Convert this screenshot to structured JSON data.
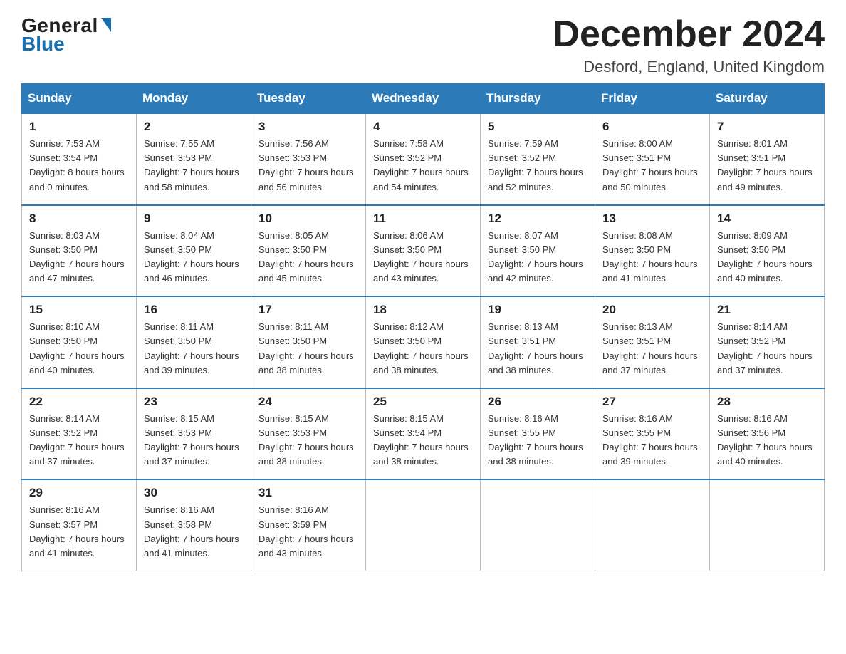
{
  "header": {
    "logo": {
      "general": "General",
      "blue": "Blue",
      "triangle": true
    },
    "month_title": "December 2024",
    "location": "Desford, England, United Kingdom"
  },
  "calendar": {
    "days_of_week": [
      "Sunday",
      "Monday",
      "Tuesday",
      "Wednesday",
      "Thursday",
      "Friday",
      "Saturday"
    ],
    "weeks": [
      [
        {
          "day": "1",
          "sunrise": "7:53 AM",
          "sunset": "3:54 PM",
          "daylight": "8 hours and 0 minutes."
        },
        {
          "day": "2",
          "sunrise": "7:55 AM",
          "sunset": "3:53 PM",
          "daylight": "7 hours and 58 minutes."
        },
        {
          "day": "3",
          "sunrise": "7:56 AM",
          "sunset": "3:53 PM",
          "daylight": "7 hours and 56 minutes."
        },
        {
          "day": "4",
          "sunrise": "7:58 AM",
          "sunset": "3:52 PM",
          "daylight": "7 hours and 54 minutes."
        },
        {
          "day": "5",
          "sunrise": "7:59 AM",
          "sunset": "3:52 PM",
          "daylight": "7 hours and 52 minutes."
        },
        {
          "day": "6",
          "sunrise": "8:00 AM",
          "sunset": "3:51 PM",
          "daylight": "7 hours and 50 minutes."
        },
        {
          "day": "7",
          "sunrise": "8:01 AM",
          "sunset": "3:51 PM",
          "daylight": "7 hours and 49 minutes."
        }
      ],
      [
        {
          "day": "8",
          "sunrise": "8:03 AM",
          "sunset": "3:50 PM",
          "daylight": "7 hours and 47 minutes."
        },
        {
          "day": "9",
          "sunrise": "8:04 AM",
          "sunset": "3:50 PM",
          "daylight": "7 hours and 46 minutes."
        },
        {
          "day": "10",
          "sunrise": "8:05 AM",
          "sunset": "3:50 PM",
          "daylight": "7 hours and 45 minutes."
        },
        {
          "day": "11",
          "sunrise": "8:06 AM",
          "sunset": "3:50 PM",
          "daylight": "7 hours and 43 minutes."
        },
        {
          "day": "12",
          "sunrise": "8:07 AM",
          "sunset": "3:50 PM",
          "daylight": "7 hours and 42 minutes."
        },
        {
          "day": "13",
          "sunrise": "8:08 AM",
          "sunset": "3:50 PM",
          "daylight": "7 hours and 41 minutes."
        },
        {
          "day": "14",
          "sunrise": "8:09 AM",
          "sunset": "3:50 PM",
          "daylight": "7 hours and 40 minutes."
        }
      ],
      [
        {
          "day": "15",
          "sunrise": "8:10 AM",
          "sunset": "3:50 PM",
          "daylight": "7 hours and 40 minutes."
        },
        {
          "day": "16",
          "sunrise": "8:11 AM",
          "sunset": "3:50 PM",
          "daylight": "7 hours and 39 minutes."
        },
        {
          "day": "17",
          "sunrise": "8:11 AM",
          "sunset": "3:50 PM",
          "daylight": "7 hours and 38 minutes."
        },
        {
          "day": "18",
          "sunrise": "8:12 AM",
          "sunset": "3:50 PM",
          "daylight": "7 hours and 38 minutes."
        },
        {
          "day": "19",
          "sunrise": "8:13 AM",
          "sunset": "3:51 PM",
          "daylight": "7 hours and 38 minutes."
        },
        {
          "day": "20",
          "sunrise": "8:13 AM",
          "sunset": "3:51 PM",
          "daylight": "7 hours and 37 minutes."
        },
        {
          "day": "21",
          "sunrise": "8:14 AM",
          "sunset": "3:52 PM",
          "daylight": "7 hours and 37 minutes."
        }
      ],
      [
        {
          "day": "22",
          "sunrise": "8:14 AM",
          "sunset": "3:52 PM",
          "daylight": "7 hours and 37 minutes."
        },
        {
          "day": "23",
          "sunrise": "8:15 AM",
          "sunset": "3:53 PM",
          "daylight": "7 hours and 37 minutes."
        },
        {
          "day": "24",
          "sunrise": "8:15 AM",
          "sunset": "3:53 PM",
          "daylight": "7 hours and 38 minutes."
        },
        {
          "day": "25",
          "sunrise": "8:15 AM",
          "sunset": "3:54 PM",
          "daylight": "7 hours and 38 minutes."
        },
        {
          "day": "26",
          "sunrise": "8:16 AM",
          "sunset": "3:55 PM",
          "daylight": "7 hours and 38 minutes."
        },
        {
          "day": "27",
          "sunrise": "8:16 AM",
          "sunset": "3:55 PM",
          "daylight": "7 hours and 39 minutes."
        },
        {
          "day": "28",
          "sunrise": "8:16 AM",
          "sunset": "3:56 PM",
          "daylight": "7 hours and 40 minutes."
        }
      ],
      [
        {
          "day": "29",
          "sunrise": "8:16 AM",
          "sunset": "3:57 PM",
          "daylight": "7 hours and 41 minutes."
        },
        {
          "day": "30",
          "sunrise": "8:16 AM",
          "sunset": "3:58 PM",
          "daylight": "7 hours and 41 minutes."
        },
        {
          "day": "31",
          "sunrise": "8:16 AM",
          "sunset": "3:59 PM",
          "daylight": "7 hours and 43 minutes."
        },
        null,
        null,
        null,
        null
      ]
    ]
  }
}
